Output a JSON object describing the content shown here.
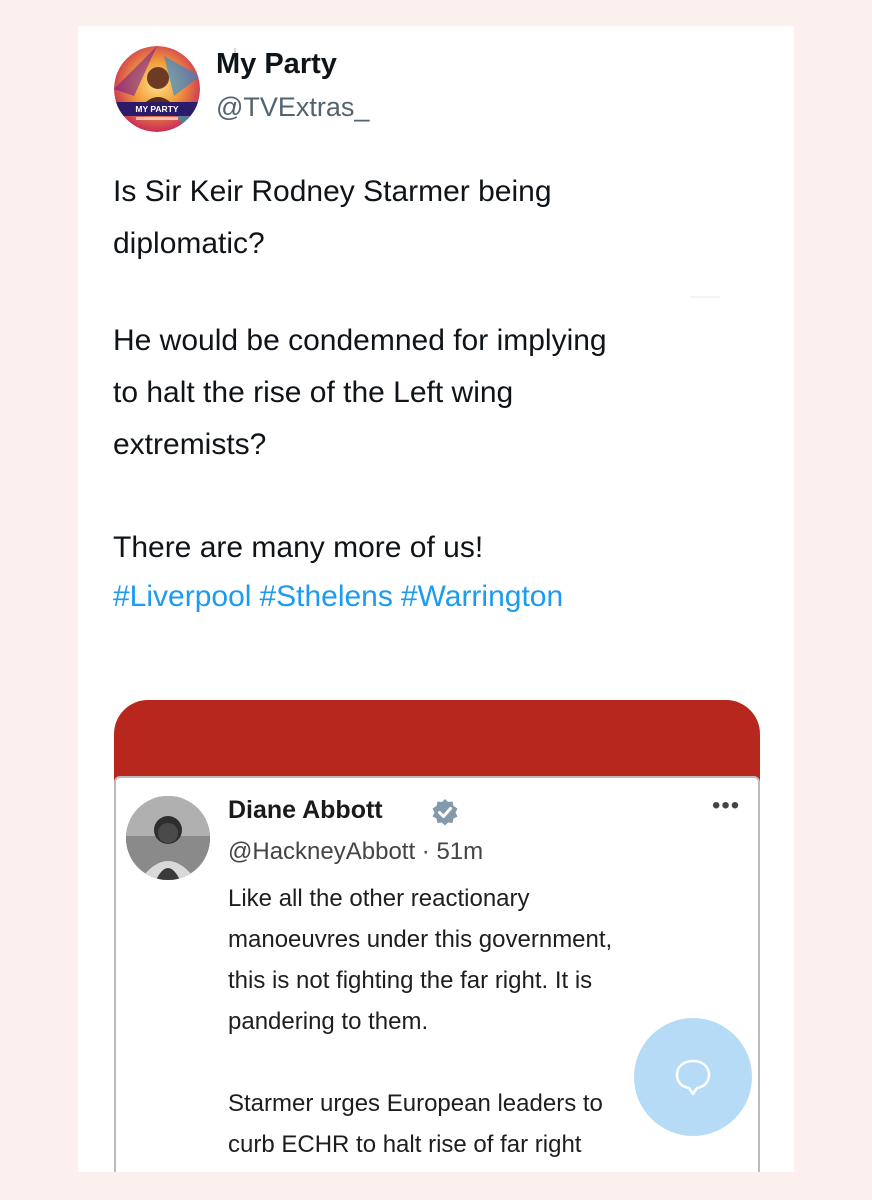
{
  "post": {
    "author_name": "My Party",
    "author_handle": "@TVExtras_",
    "avatar_text": "MY PARTY",
    "paragraphs": [
      [
        "Is Sir Keir Rodney Starmer being",
        "diplomatic?"
      ],
      [
        "He would be condemned for implying",
        "to halt the rise of the Left wing",
        "extremists?"
      ],
      [
        "There are many more of us!"
      ]
    ],
    "hashtags": [
      "#Liverpool",
      "#Sthelens",
      "#Warrington"
    ]
  },
  "quoted": {
    "author_name": "Diane Abbott",
    "handle_time": "@HackneyAbbott · 51m",
    "more_label": "•••",
    "lines": [
      "Like all the other reactionary",
      "manoeuvres under this government,",
      "this is not fighting the far right. It is",
      "pandering to them.",
      "",
      "Starmer urges European leaders to",
      "curb ECHR to halt rise of far right"
    ]
  },
  "colors": {
    "hashtag": "#1d9bf0",
    "embed_header": "#b8271e",
    "verified": "#829aab",
    "background": "#fbf0ee"
  },
  "icons": {
    "verified": "verified-badge-icon",
    "reply_fab": "chat-bubble-icon",
    "more": "more-options-icon"
  }
}
